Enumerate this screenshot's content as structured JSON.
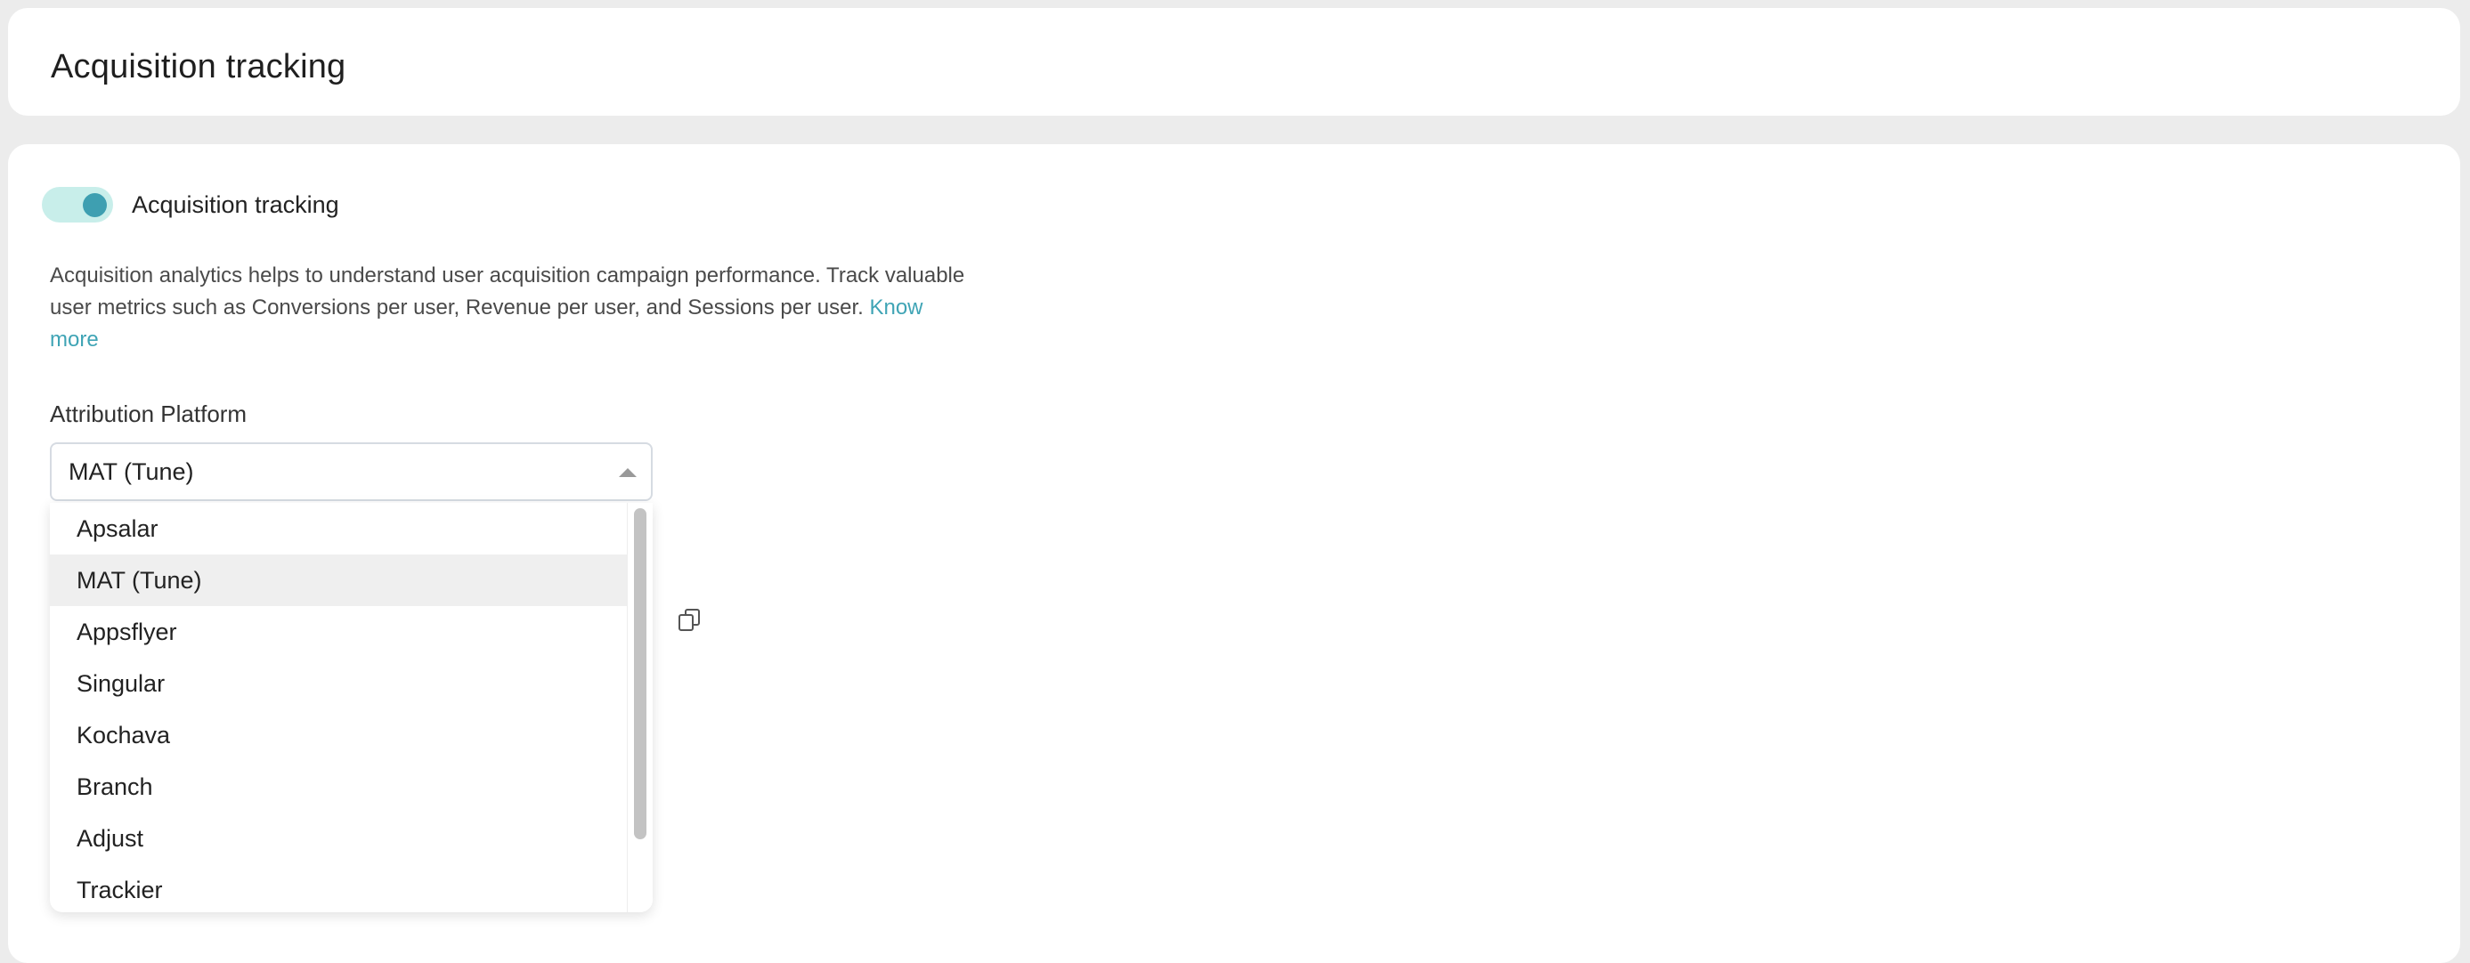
{
  "header": {
    "title": "Acquisition tracking"
  },
  "toggle": {
    "label": "Acquisition tracking",
    "enabled": true
  },
  "description": {
    "text": "Acquisition analytics helps to understand user acquisition campaign performance. Track valuable user metrics such as Conversions per user, Revenue per user, and Sessions per user.",
    "link_label": "Know more"
  },
  "attribution": {
    "label": "Attribution Platform",
    "selected": "MAT (Tune)",
    "options": [
      "Apsalar",
      "MAT (Tune)",
      "Appsflyer",
      "Singular",
      "Kochava",
      "Branch",
      "Adjust",
      "Trackier"
    ],
    "selected_index": 1
  },
  "icons": {
    "toggle_state": "toggle-on-icon",
    "select_caret": "caret-up-icon",
    "copy": "copy-icon"
  },
  "colors": {
    "accent": "#3e9fb1",
    "toggle_track": "#c8eeea",
    "link": "#3fa4b5"
  }
}
